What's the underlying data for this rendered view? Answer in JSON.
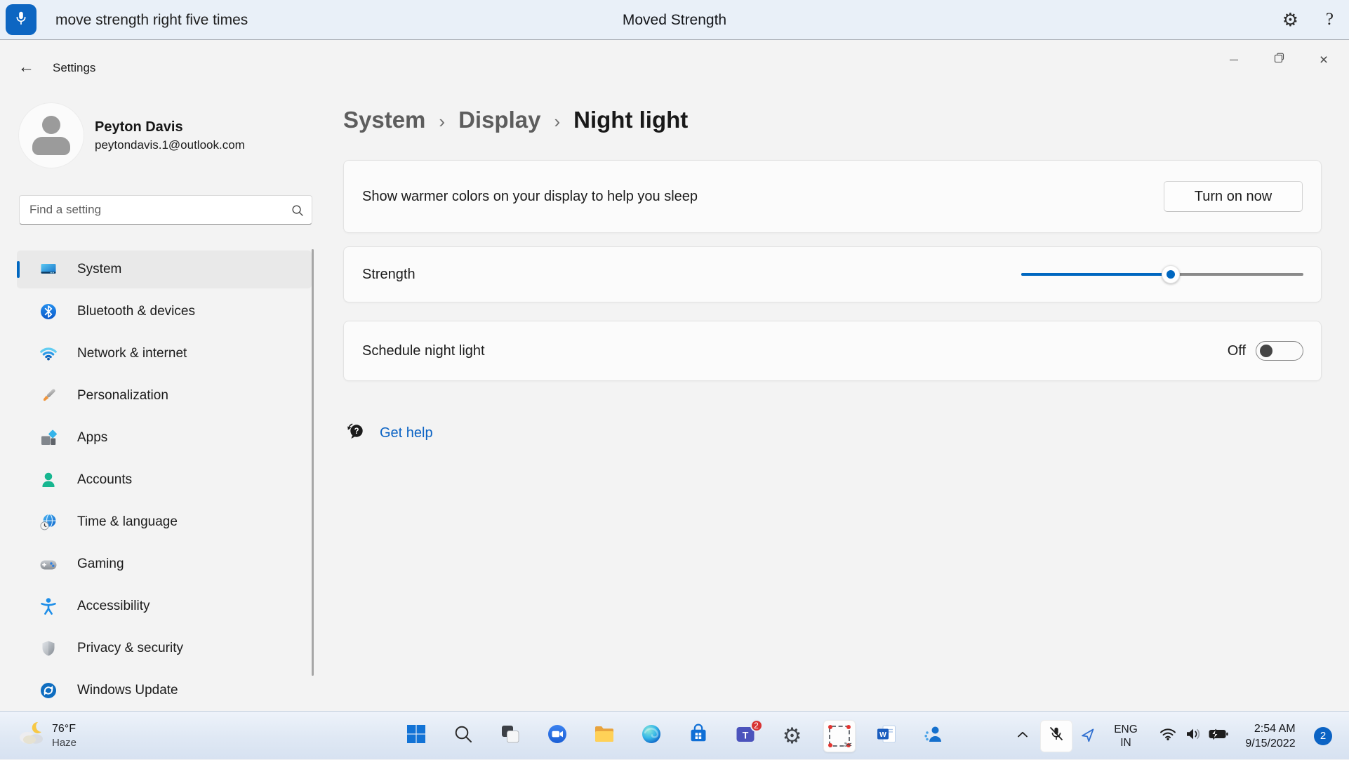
{
  "voice_bar": {
    "command": "move strength right five times",
    "status": "Moved Strength"
  },
  "icons": {
    "help_glyph": "?",
    "breadcrumb_separator": "›"
  },
  "window": {
    "title": "Settings"
  },
  "sidebar": {
    "user": {
      "name": "Peyton Davis",
      "email": "peytondavis.1@outlook.com"
    },
    "search": {
      "placeholder": "Find a setting"
    },
    "items": [
      {
        "label": "System",
        "selected": true
      },
      {
        "label": "Bluetooth & devices"
      },
      {
        "label": "Network & internet"
      },
      {
        "label": "Personalization"
      },
      {
        "label": "Apps"
      },
      {
        "label": "Accounts"
      },
      {
        "label": "Time & language"
      },
      {
        "label": "Gaming"
      },
      {
        "label": "Accessibility"
      },
      {
        "label": "Privacy & security"
      },
      {
        "label": "Windows Update"
      }
    ]
  },
  "main": {
    "breadcrumb": [
      "System",
      "Display",
      "Night light"
    ],
    "warm_card": {
      "label": "Show warmer colors on your display to help you sleep",
      "button": "Turn on now"
    },
    "strength_card": {
      "label": "Strength",
      "percent": 53
    },
    "schedule_card": {
      "label": "Schedule night light",
      "state": "Off"
    },
    "get_help": "Get help"
  },
  "taskbar": {
    "weather": {
      "temperature": "76°F",
      "condition": "Haze"
    },
    "apps": [
      "start",
      "search",
      "task-view",
      "chat",
      "file-explorer",
      "edge",
      "microsoft-store",
      "teams",
      "settings",
      "snipping-tool",
      "word",
      "voice-access"
    ],
    "teams_badge": "2",
    "tray": {
      "language": "ENG",
      "region": "IN",
      "time": "2:54 AM",
      "date": "9/15/2022",
      "notification_count": "2"
    }
  },
  "colors": {
    "accent": "#0067c0",
    "voice_bar_bg": "#e9f0f8",
    "window_bg": "#f3f3f3",
    "card_bg": "#fbfbfb",
    "link": "#0b63c4"
  }
}
